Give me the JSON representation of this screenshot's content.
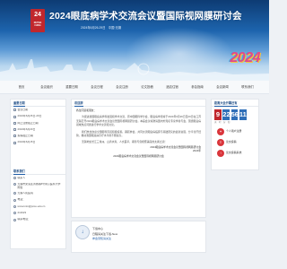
{
  "banner": {
    "logo_number": "24",
    "logo_text": "RETINA CHINA",
    "title": "2024眼底病学术交流会议暨国际视网膜研讨会",
    "subtitle": "2024年6月26-29日　中国·无锡",
    "year_deco": "2024"
  },
  "nav": {
    "items": [
      "首页",
      "会议组织",
      "重要日期",
      "会议日程",
      "会议注册",
      "论文投稿",
      "酒店住宿",
      "参会指南",
      "会议新闻",
      "联系我们"
    ]
  },
  "sidebar": {
    "dates_title": "重要日期",
    "dates": [
      "会议日期",
      "2024年6月26日-29日",
      "网上注册截止日期",
      "2024年6月20日",
      "投稿截止日期",
      "2024年6月15日"
    ],
    "contact_title": "联系我们",
    "contact": [
      "联系人",
      "无锡市梁溪区清扬路8号南京医科大学附属",
      "无锡人民医院",
      "电话：",
      "wxrenmin@jsmu.edu.cn",
      "214023",
      "联系电话："
    ]
  },
  "main": {
    "title": "欢迎辞",
    "greeting": "各位同道和朋友：",
    "paragraphs": [
      "为促进我国眼底病学科发展和学术交流，原中国眼科学分会、眼底病学组将于2024年6月26日至29日在江苏无锡召开2024眼底病学术交流会议暨国际视网膜研讨会。本届会议将邀请国内外知名专家学者与会，围绕眼底病领域热点问题进行学术交流和讨论。",
      "我们热忱欢迎全国眼科同道积极投稿、踊跃参会，共同交流眼底病临床与基础研究的最新进展，分享诊疗经验，推动我国眼底病诊疗水平的不断提高。",
      "无锡地处长江三角洲，山清水秀，人文荟萃，期待与您相聚美丽的太湖之滨！"
    ],
    "sign": "2024眼底病学术交流会议暨国际视网膜研讨会",
    "date": "2024年",
    "note": "2024眼底病学术交流会议暨国际视网膜研讨会"
  },
  "right": {
    "title": "距离大会开幕还有",
    "countdown": [
      "9",
      "22",
      "56",
      "11"
    ],
    "countdown_label": "天　时　分　秒",
    "buttons": [
      "个人用户注册",
      "论文投稿",
      "论文投稿系统"
    ]
  },
  "mini": {
    "head": "下载中心",
    "lines": [
      "日程请关注下载-New",
      "参会须知请关注"
    ]
  }
}
